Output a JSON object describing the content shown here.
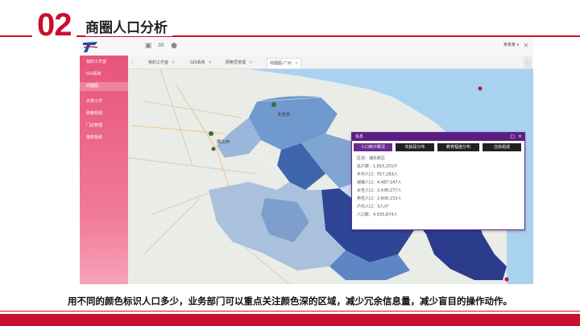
{
  "slide": {
    "number": "02",
    "title": "商圈人口分析",
    "caption": "用不同的颜色标识人口多少，业务部门可以重点关注颜色深的区域，减少冗余信息量，减少盲目的操作动作。"
  },
  "app": {
    "user_menu": "某某某 ▾",
    "sidebar": {
      "items": [
        {
          "label": "我的工作室"
        },
        {
          "label": "GIS系统"
        },
        {
          "label": "商圈图"
        },
        {
          "label": "日常工作"
        },
        {
          "label": "网格规划"
        },
        {
          "label": "门店管理"
        },
        {
          "label": "报表系统"
        }
      ]
    },
    "tabs": [
      {
        "label": "我的工作室"
      },
      {
        "label": "GIS系统"
      },
      {
        "label": "网格员管理"
      },
      {
        "label": "商圈图-广州"
      }
    ],
    "map": {
      "labels": [
        "太仓市",
        "昆山市"
      ]
    },
    "popup": {
      "title": "信息",
      "tabs": [
        "人口统计概况",
        "年龄段分布",
        "教育程度分布",
        "住房组成"
      ],
      "lines": [
        "区划：浦东新区",
        "总户数：1,815,251户",
        "乡村人口：557,283人",
        "城镇人口：4,487,147人",
        "女性人口：2,438,277人",
        "男性人口：2,606,153人",
        "户均人口：3人/户",
        "人口数：4,555,874人"
      ]
    },
    "colors": {
      "sidebar": "#e8547a",
      "popup_header": "#5a1e82",
      "district_dark": "#2b3c8c",
      "district_mid": "#4f7fc0",
      "district_light": "#a9c1dd",
      "sea": "#a9d2f0"
    }
  }
}
